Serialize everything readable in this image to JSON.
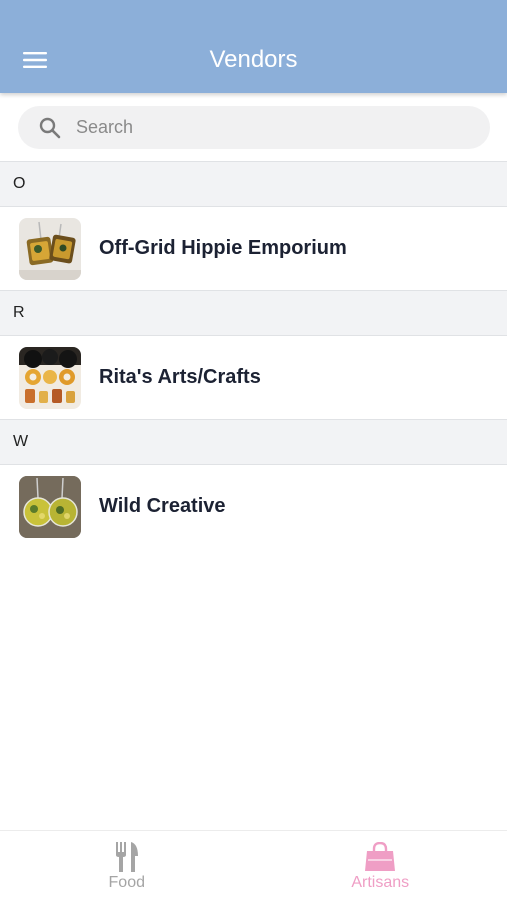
{
  "header": {
    "title": "Vendors",
    "menu_icon": "hamburger-menu-icon"
  },
  "search": {
    "placeholder": "Search",
    "value": "",
    "icon": "search-icon"
  },
  "sections": [
    {
      "letter": "O",
      "vendors": [
        {
          "name": "Off-Grid Hippie Emporium",
          "thumbnail": "earrings-photo"
        }
      ]
    },
    {
      "letter": "R",
      "vendors": [
        {
          "name": "Rita's Arts/Crafts",
          "thumbnail": "crafts-photo"
        }
      ]
    },
    {
      "letter": "W",
      "vendors": [
        {
          "name": "Wild Creative",
          "thumbnail": "resin-earrings-photo"
        }
      ]
    }
  ],
  "tabs": [
    {
      "label": "Food",
      "icon": "fork-knife-icon",
      "active": false
    },
    {
      "label": "Artisans",
      "icon": "shopping-bag-icon",
      "active": true
    }
  ],
  "colors": {
    "header_bg": "#8cafd9",
    "section_bg": "#f2f3f5",
    "active_tab": "#ef9ec5",
    "inactive_tab": "#a5a5a5",
    "vendor_text": "#1c2233"
  }
}
